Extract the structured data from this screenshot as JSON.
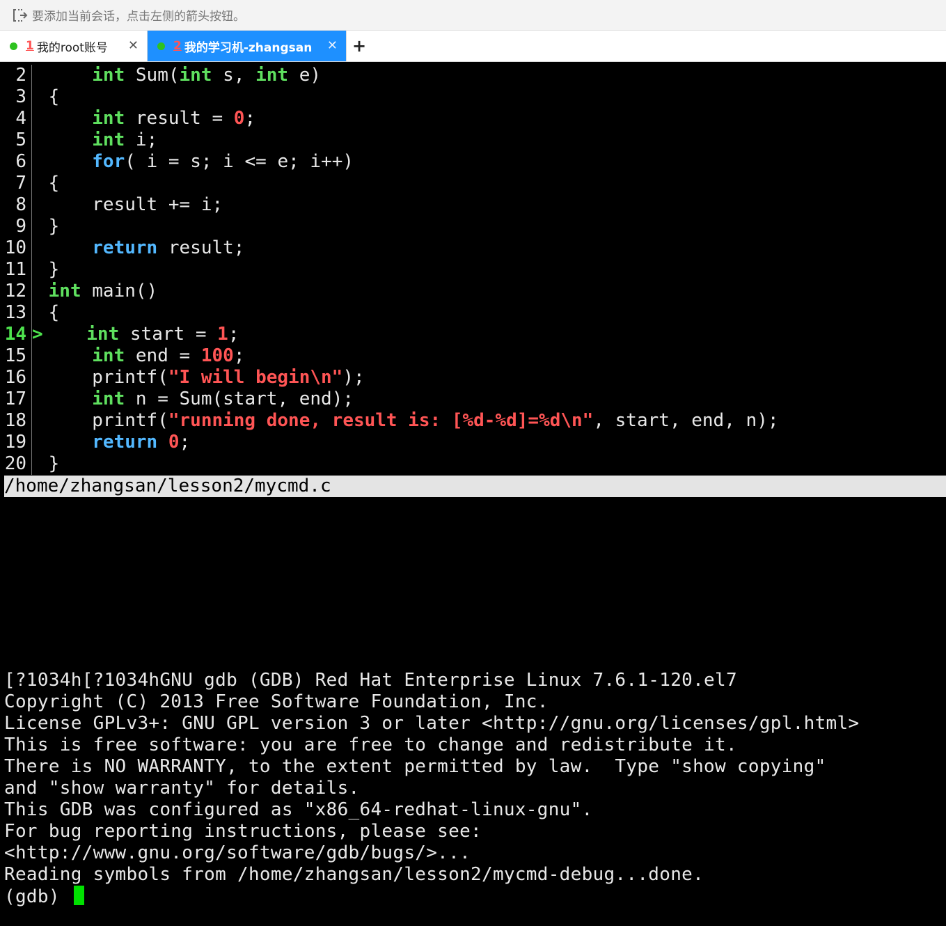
{
  "hintbar": {
    "text": "要添加当前会话，点击左侧的箭头按钮。",
    "icon": "add-session-arrow-icon"
  },
  "tabs": [
    {
      "num": "1",
      "label": "我的root账号",
      "active": false,
      "status_color": "#2ec21f"
    },
    {
      "num": "2",
      "label": "我的学习机-zhangsan",
      "active": true,
      "status_color": "#2ec21f"
    }
  ],
  "addtab": {
    "label": "+"
  },
  "colors": {
    "active_tab": "#1e90ff",
    "keyword_type": "#5fe05f",
    "keyword_control": "#53b8ff",
    "literal": "#ff5555",
    "cursor": "#00e000"
  },
  "code": {
    "lines": [
      {
        "n": "2",
        "text": "     int Sum(int s, int e)"
      },
      {
        "n": "3",
        "text": " {"
      },
      {
        "n": "4",
        "text": "     int result = 0;"
      },
      {
        "n": "5",
        "text": "     int i;"
      },
      {
        "n": "6",
        "text": "     for( i = s; i <= e; i++)"
      },
      {
        "n": "7",
        "text": " {"
      },
      {
        "n": "8",
        "text": "     result += i;"
      },
      {
        "n": "9",
        "text": " }"
      },
      {
        "n": "10",
        "text": "     return result;"
      },
      {
        "n": "11",
        "text": " }"
      },
      {
        "n": "12",
        "text": " int main()"
      },
      {
        "n": "13",
        "text": " {"
      },
      {
        "n": "14",
        "text": "     int start = 1;",
        "current": true,
        "marker": ">"
      },
      {
        "n": "15",
        "text": "     int end = 100;"
      },
      {
        "n": "16",
        "text": "     printf(\"I will begin\\n\");"
      },
      {
        "n": "17",
        "text": "     int n = Sum(start, end);"
      },
      {
        "n": "18",
        "text": "     printf(\"running done, result is: [%d-%d]=%d\\n\", start, end, n);"
      },
      {
        "n": "19",
        "text": "     return 0;"
      },
      {
        "n": "20",
        "text": " }"
      }
    ]
  },
  "statusbar": {
    "text": "/home/zhangsan/lesson2/mycmd.c"
  },
  "gdb": {
    "lines": [
      "[?1034h[?1034hGNU gdb (GDB) Red Hat Enterprise Linux 7.6.1-120.el7",
      "Copyright (C) 2013 Free Software Foundation, Inc.",
      "License GPLv3+: GNU GPL version 3 or later <http://gnu.org/licenses/gpl.html>",
      "This is free software: you are free to change and redistribute it.",
      "There is NO WARRANTY, to the extent permitted by law.  Type \"show copying\"",
      "and \"show warranty\" for details.",
      "This GDB was configured as \"x86_64-redhat-linux-gnu\".",
      "For bug reporting instructions, please see:",
      "<http://www.gnu.org/software/gdb/bugs/>...",
      "Reading symbols from /home/zhangsan/lesson2/mycmd-debug...done."
    ],
    "prompt": "(gdb) "
  }
}
